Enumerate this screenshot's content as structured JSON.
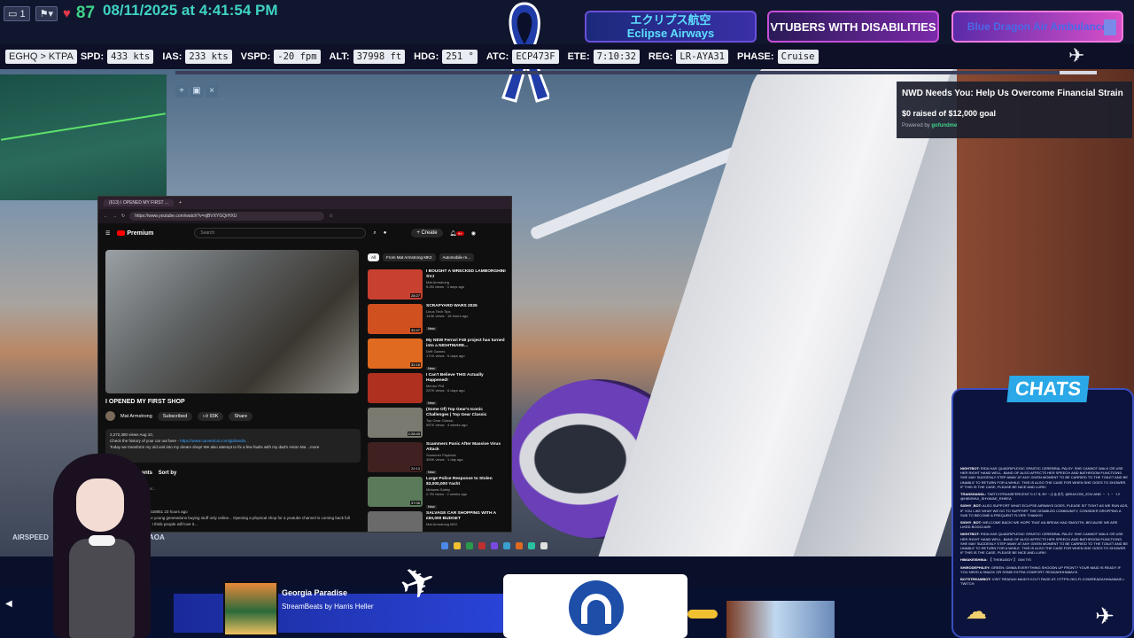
{
  "top": {
    "tray_count": "1",
    "viewer_count": "87",
    "datetime": "08/11/2025 at 4:41:54 PM",
    "banners": [
      {
        "line1": "エクリプス航空",
        "line2": "Eclipse Airways"
      },
      {
        "line1": "VTUBERS WITH DISABILITIES"
      },
      {
        "line1": "Blue Dragon Air Ambulance"
      }
    ]
  },
  "flight": {
    "route": "EGHQ > KTPA",
    "fields": [
      {
        "label": "SPD:",
        "value": "433 kts"
      },
      {
        "label": "IAS:",
        "value": "233 kts"
      },
      {
        "label": "VSPD:",
        "value": "-20 fpm"
      },
      {
        "label": "ALT:",
        "value": "37998 ft"
      },
      {
        "label": "HDG:",
        "value": "251 °"
      },
      {
        "label": "ATC:",
        "value": "ECP473F"
      },
      {
        "label": "ETE:",
        "value": "7:10:32"
      },
      {
        "label": "REG:",
        "value": "LR-AYA31"
      },
      {
        "label": "PHASE:",
        "value": "Cruise"
      }
    ],
    "progress_fraction": 0.96
  },
  "donation": {
    "title": "NWD Needs You: Help Us Overcome Financial Strain",
    "goal": "$0 raised of $12,000 goal",
    "powered": "Powered by",
    "brand": "gofundme"
  },
  "browser": {
    "tab_title": "(613) I OPENED MY FIRST ...",
    "url": "https://www.youtube.com/watch?v=xjBVXYGQrHXU",
    "logo": "Premium",
    "search_placeholder": "Search",
    "create_label": "+ Create",
    "notif_count": "9+",
    "video_title": "I OPENED MY FIRST SHOP",
    "channel": "Mat Armstrong",
    "subscribers": "2.78M subscribers",
    "subscribed_label": "Subscribed",
    "likes": "93K",
    "share_label": "Share",
    "description": {
      "stats": "2,272,380 views  Aug 10,",
      "line1": "Check the history of your car out here -",
      "link": "https://www.carvertical.com/gb/landin...",
      "line2": "Today we transform my old unit into my dream shop! We also attempt to fix a few faults with my dad's Aston Ma ...more"
    },
    "comments_label": "Comments",
    "sort_label": "Sort by",
    "add_comment": "Add a comment...",
    "comment": {
      "author": "@alexandarfetto8851  23 hours ago",
      "text": "So much for the young generations buying stuff only online... Opening a physical shop for a youtube channel is coming back full circle. GREAT! I think people will love it..."
    },
    "chips": [
      "All",
      "From Mat Armstrong MK2",
      "Automobile re..."
    ],
    "recs": [
      {
        "title": "I BOUGHT A WRECKED LAMBORGHINI SVJ",
        "channel": "Mat Armstrong",
        "meta": "5.2M views · 3 days ago",
        "dur": "28:27",
        "color": "#c84030",
        "new": ""
      },
      {
        "title": "SCRAPYARD WARS 2025",
        "channel": "Linus Tech Tips",
        "meta": "143K views · 16 hours ago",
        "dur": "32:47",
        "color": "#d05020",
        "new": "New"
      },
      {
        "title": "My NEW Ferrari F40 project has turned into a NIGHTMARE...",
        "channel": "Drift Games",
        "meta": "171K views · 6 days ago",
        "dur": "32:16",
        "color": "#e06a20",
        "new": "New"
      },
      {
        "title": "I Can't Believe THIS Actually Happened!",
        "channel": "Mentor Phil",
        "meta": "257K views · 6 days ago",
        "dur": "",
        "color": "#b03020",
        "new": "New"
      },
      {
        "title": "(Some Of) Top Gear's Iconic Challenges | Top Gear Classic",
        "channel": "Top Gear Classic",
        "meta": "557K views · 4 weeks ago",
        "dur": "2:28:40",
        "color": "#7a7a70",
        "new": ""
      },
      {
        "title": "Scammers Panic After Massive Virus Attack",
        "channel": "Scammer Payback",
        "meta": "459K views · 1 day ago",
        "dur": "22:13",
        "color": "#402020",
        "new": "New"
      },
      {
        "title": "Large Police Response to Stolen $3,000,000 Yacht",
        "channel": "Midwest Safety",
        "meta": "2.7M views · 2 weeks ago",
        "dur": "37:06",
        "color": "#5a7a5a",
        "new": "New"
      },
      {
        "title": "SALVAGE CAR SHOPPING WITH A £50,000 BUDGET",
        "channel": "Mat Armstrong MK2",
        "meta": "",
        "dur": "",
        "color": "#6a6a6a",
        "new": ""
      }
    ]
  },
  "instruments": {
    "airspeed": "AIRSPEED",
    "aoa": "AOA"
  },
  "chat": {
    "title": "CHATS",
    "messages": [
      {
        "user": "NIGHTBOT:",
        "text": "RIDA HAS QUADRIPLEGIC SPASTIC CEREBRAL PALSY. SHE CANNOT WALK OR USE HER RIGHT HAND WELL. BAND OF ALSO AFFECTS HER SPEECH AND BATHROOM FUNCTIONS. SHE MAY SUDDENLY STEP AWAY AT ANY GIVEN MOMENT TO BE CARRIED TO THE TOILET AND BE UNABLE TO RETURN FOR A WHILE. THIS IS ALSO THE CASE FOR WHEN SHE GOES TO SHOWER. IF THIS IS THE CASE, PLEASE BE NICE AND LURK!"
      },
      {
        "user": "TRANSHANDL:",
        "text": "TWITCHTRANSFERCENT 0.17 $. BY ~ふぁるた @RIACOW_ZOU AND ・ ゝ・ ゝ!! @HIBISHUI_SHYAVAE_RHEEA"
      },
      {
        "user": "SIGHY_BOT:",
        "text": "ALSO SUPPORT WHAT ECLIPSE AIRWAYS DOES, PLEASE SIT TIGHT AS WE RUN ADS, IF YOU LIKE WHAT WE DO TO SUPPORT THE DISABLED COMMUNITY, CONSIDER DROPPING A SUB TO BECOME A FREQUENT FLYER! THANKS!"
      },
      {
        "user": "SIGHY_BOT:",
        "text": "WELCOME BACK! WE HOPE THAT AN BREAK HAD SMOOTH, BECAUSE WE ARE LIKED BOGGI AIR!"
      },
      {
        "user": "NIGHTBOT:",
        "text": "RIDA HAS QUADRIPLEGIC SPASTIC CEREBRAL PALSY. SHE CANNOT WALK OR USE HER RIGHT HAND WELL. BAND OF ALSO AFFECTS HER SPEECH AND BATHROOM FUNCTIONS. SHE MAY SUDDENLY STEP AWAY AT ANY GIVEN MOMENT TO BE CARRIED TO THE TOILET AND BE UNABLE TO RETURN FOR A WHILE. THIS IS ALSO THE CASE FOR WHEN SHE GOES TO SHOWER. IF THIS IS THE CASE, PLEASE BE NICE AND LURK!"
      },
      {
        "user": "HIMAKEISHINA:",
        "text": "【 THEBUDDY 】 GIM TIS"
      },
      {
        "user": "SHIRODEPHILEY:",
        "text": "GREEN: GMMA EVERYTHING SHOODN UP FRONT? YOUR MAID IS READY IF YOU NEED A SNACK OR SOME EXTRA COMFORT. READAHHHABACK"
      },
      {
        "user": "BOTSTREAMBOT:",
        "text": "VISIT READAH MAID'S KO-FI PAGE AT: HTTPS://KO-FI.COM/READAHHAAMAID • TWITCH"
      }
    ]
  },
  "music": {
    "title": "Georgia Paradise",
    "artist": "StreamBeats by Harris Heller"
  },
  "colors": {
    "accent": "#3fd2c2",
    "live_green": "#3fd28a",
    "chat_title_bg": "#2aa8e8"
  }
}
